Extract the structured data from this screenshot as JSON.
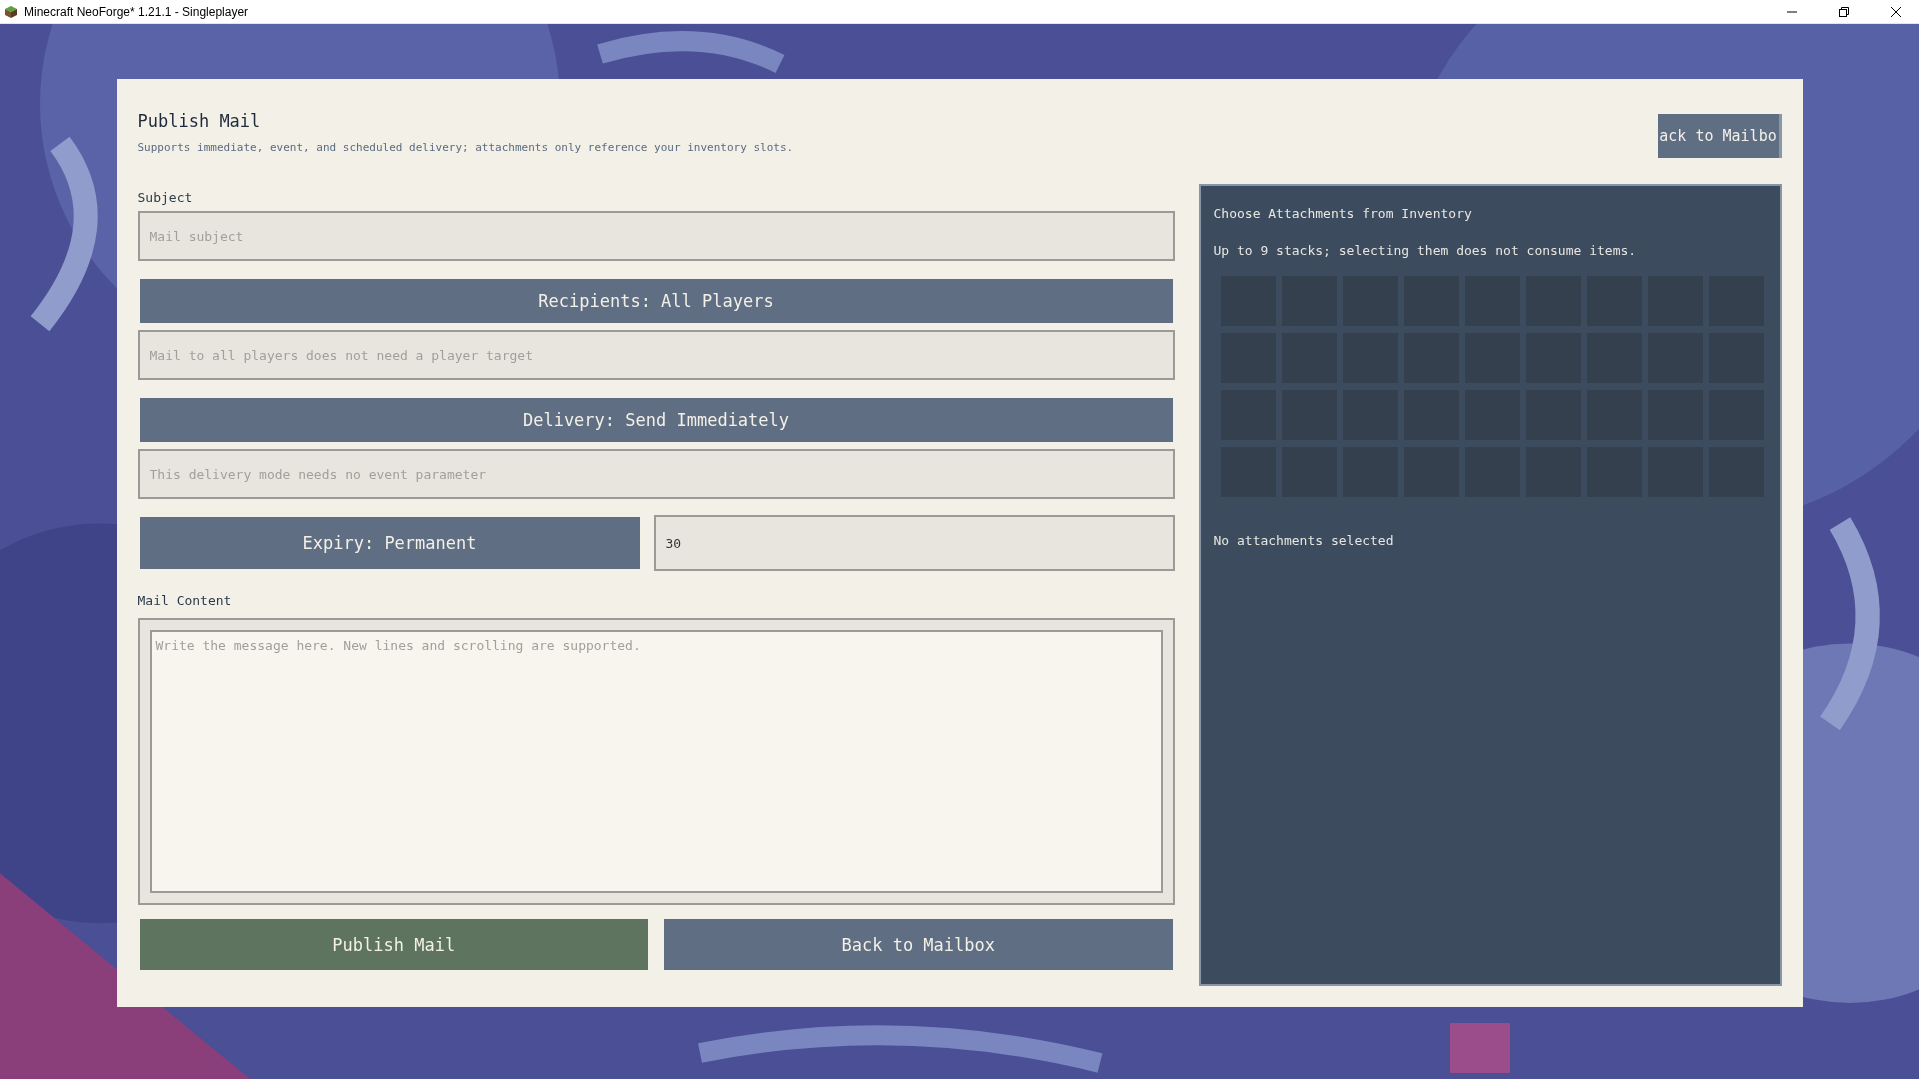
{
  "window": {
    "title": "Minecraft NeoForge* 1.21.1 - Singleplayer"
  },
  "header": {
    "title": "Publish Mail",
    "subtitle": "Supports immediate, event, and scheduled delivery; attachments only reference your inventory slots.",
    "back_button": "ack to Mailbo"
  },
  "subject": {
    "label": "Subject",
    "placeholder": "Mail subject"
  },
  "recipients": {
    "button": "Recipients: All Players",
    "placeholder": "Mail to all players does not need a player target"
  },
  "delivery": {
    "button": "Delivery: Send Immediately",
    "placeholder": "This delivery mode needs no event parameter"
  },
  "expiry": {
    "button": "Expiry: Permanent",
    "value": "30"
  },
  "content": {
    "label": "Mail Content",
    "placeholder": "Write the message here. New lines and scrolling are supported."
  },
  "actions": [
    {
      "label": "Publish Mail",
      "kind": "primary"
    },
    {
      "label": "Back to Mailbox",
      "kind": "secondary"
    }
  ],
  "attachments": {
    "title": "Choose Attachments from Inventory",
    "hint": "Up to 9 stacks; selecting them does not consume items.",
    "status": "No attachments selected",
    "slots": [
      {
        "selected": false
      },
      {
        "selected": false
      },
      {
        "selected": false
      },
      {
        "selected": false
      },
      {
        "selected": false
      },
      {
        "selected": false
      },
      {
        "selected": false
      },
      {
        "selected": false
      },
      {
        "selected": false
      },
      {
        "selected": false
      },
      {
        "selected": false
      },
      {
        "selected": false
      },
      {
        "selected": false
      },
      {
        "selected": false
      },
      {
        "selected": false
      },
      {
        "selected": false
      },
      {
        "selected": false
      },
      {
        "selected": false
      },
      {
        "selected": false
      },
      {
        "selected": false
      },
      {
        "selected": false
      },
      {
        "selected": false
      },
      {
        "selected": false
      },
      {
        "selected": false
      },
      {
        "selected": false
      },
      {
        "selected": false
      },
      {
        "selected": false
      },
      {
        "selected": false
      },
      {
        "selected": false
      },
      {
        "selected": false
      },
      {
        "selected": false
      },
      {
        "selected": false
      },
      {
        "selected": false
      },
      {
        "selected": false
      },
      {
        "selected": false
      },
      {
        "selected": false
      }
    ]
  }
}
